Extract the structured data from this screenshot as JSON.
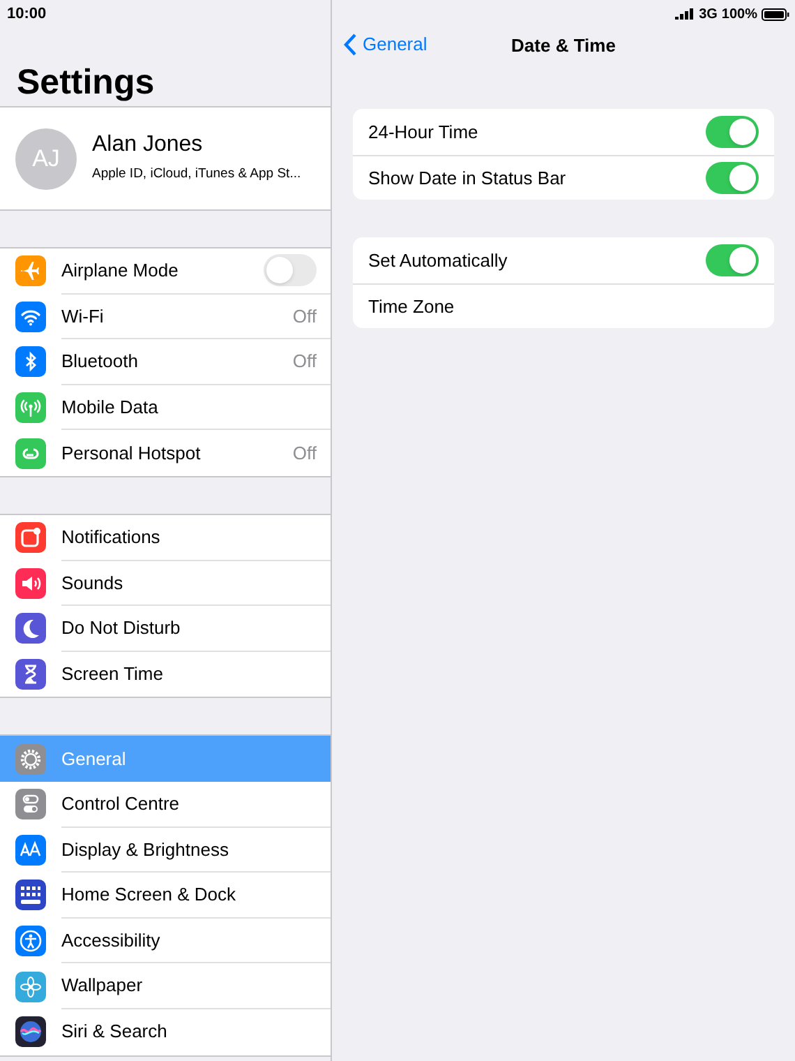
{
  "status_bar": {
    "time": "10:00",
    "network": "3G",
    "battery": "100%"
  },
  "sidebar": {
    "title": "Settings",
    "profile": {
      "initials": "AJ",
      "name": "Alan Jones",
      "subtitle": "Apple ID, iCloud, iTunes & App St..."
    },
    "groups": [
      {
        "items": [
          {
            "label": "Airplane Mode",
            "kind": "toggle",
            "on": false,
            "selected": false,
            "color": "#ff9500"
          },
          {
            "label": "Wi-Fi",
            "kind": "detail",
            "value": "Off",
            "selected": false,
            "color": "#007aff"
          },
          {
            "label": "Bluetooth",
            "kind": "detail",
            "value": "Off",
            "selected": false,
            "color": "#007aff"
          },
          {
            "label": "Mobile Data",
            "kind": "link",
            "selected": false,
            "color": "#34c759"
          },
          {
            "label": "Personal Hotspot",
            "kind": "detail",
            "value": "Off",
            "selected": false,
            "color": "#34c759"
          }
        ]
      },
      {
        "items": [
          {
            "label": "Notifications",
            "kind": "link",
            "selected": false,
            "color": "#ff3b30"
          },
          {
            "label": "Sounds",
            "kind": "link",
            "selected": false,
            "color": "#ff2d55"
          },
          {
            "label": "Do Not Disturb",
            "kind": "link",
            "selected": false,
            "color": "#5856d6"
          },
          {
            "label": "Screen Time",
            "kind": "link",
            "selected": false,
            "color": "#5856d6"
          }
        ]
      },
      {
        "items": [
          {
            "label": "General",
            "kind": "link",
            "selected": true,
            "color": "#8e8e93"
          },
          {
            "label": "Control Centre",
            "kind": "link",
            "selected": false,
            "color": "#8e8e93"
          },
          {
            "label": "Display & Brightness",
            "kind": "link",
            "selected": false,
            "color": "#007aff"
          },
          {
            "label": "Home Screen & Dock",
            "kind": "link",
            "selected": false,
            "color": "#2c46c7"
          },
          {
            "label": "Accessibility",
            "kind": "link",
            "selected": false,
            "color": "#007aff"
          },
          {
            "label": "Wallpaper",
            "kind": "link",
            "selected": false,
            "color": "#35aadc"
          },
          {
            "label": "Siri & Search",
            "kind": "link",
            "selected": false,
            "color": "#222233"
          }
        ]
      }
    ]
  },
  "detail": {
    "back": "General",
    "title": "Date & Time",
    "groups": [
      {
        "items": [
          {
            "label": "24-Hour Time",
            "kind": "toggle",
            "on": true
          },
          {
            "label": "Show Date in Status Bar",
            "kind": "toggle",
            "on": true
          }
        ]
      },
      {
        "items": [
          {
            "label": "Set Automatically",
            "kind": "toggle",
            "on": true
          },
          {
            "label": "Time Zone",
            "kind": "link"
          }
        ]
      }
    ]
  }
}
